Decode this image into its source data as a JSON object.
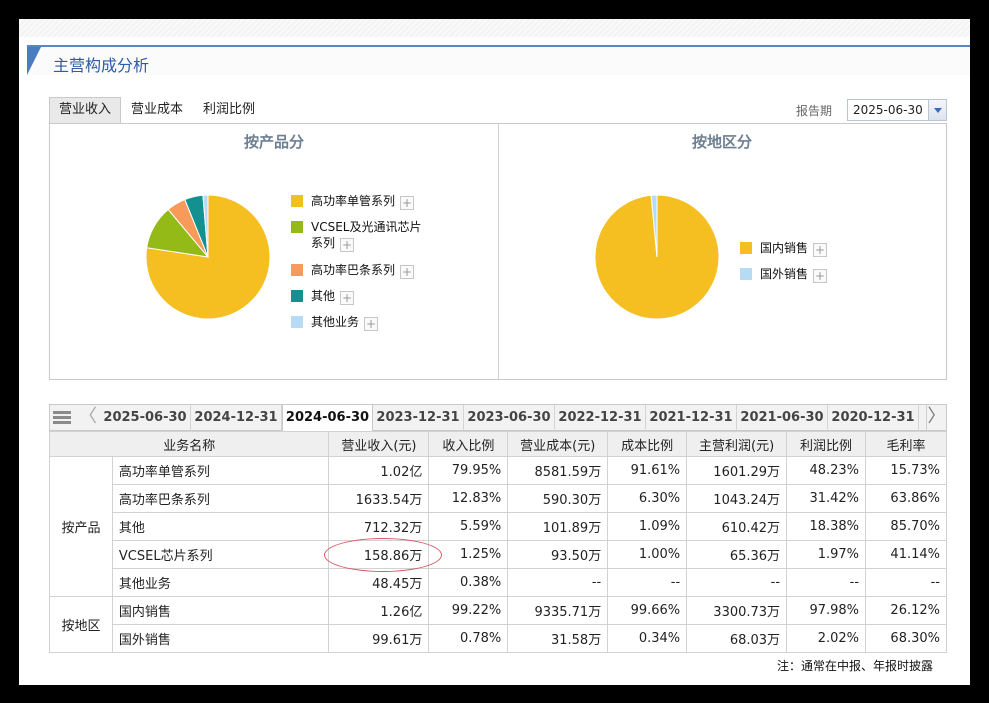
{
  "section_title": "主营构成分析",
  "top_tabs": [
    {
      "label": "营业收入",
      "active": true
    },
    {
      "label": "营业成本",
      "active": false
    },
    {
      "label": "利润比例",
      "active": false
    }
  ],
  "report_period": {
    "label": "报告期",
    "value": "2025-06-30"
  },
  "charts": {
    "product": {
      "title": "按产品分",
      "legend": [
        {
          "label": "高功率单管系列",
          "color": "#f5bf22"
        },
        {
          "label": "VCSEL及光通讯芯片系列",
          "color": "#93ba16"
        },
        {
          "label": "高功率巴条系列",
          "color": "#f89a5a"
        },
        {
          "label": "其他",
          "color": "#159091"
        },
        {
          "label": "其他业务",
          "color": "#b7dbf4"
        }
      ]
    },
    "region": {
      "title": "按地区分",
      "legend": [
        {
          "label": "国内销售",
          "color": "#f5bf22"
        },
        {
          "label": "国外销售",
          "color": "#b7dbf4"
        }
      ]
    },
    "plus_symbol": "+"
  },
  "chart_data": [
    {
      "type": "pie",
      "title": "按产品分",
      "categories": [
        "高功率单管系列",
        "VCSEL及光通讯芯片系列",
        "高功率巴条系列",
        "其他",
        "其他业务"
      ],
      "values": [
        77.4,
        11.5,
        5.0,
        4.8,
        1.3
      ],
      "colors": [
        "#f5bf22",
        "#93ba16",
        "#f89a5a",
        "#159091",
        "#b7dbf4"
      ]
    },
    {
      "type": "pie",
      "title": "按地区分",
      "categories": [
        "国内销售",
        "国外销售"
      ],
      "values": [
        98.5,
        1.5
      ],
      "colors": [
        "#f5bf22",
        "#b7dbf4"
      ]
    }
  ],
  "date_tabs": {
    "prev_symbol": "〈",
    "next_symbol": "〉",
    "items": [
      "2025-06-30",
      "2024-12-31",
      "2024-06-30",
      "2023-12-31",
      "2023-06-30",
      "2022-12-31",
      "2021-12-31",
      "2021-06-30",
      "2020-12-31"
    ],
    "active_index": 2
  },
  "table": {
    "headers": [
      "业务名称",
      "营业收入(元)",
      "收入比例",
      "营业成本(元)",
      "成本比例",
      "主营利润(元)",
      "利润比例",
      "毛利率"
    ],
    "groups": [
      {
        "label": "按产品",
        "rows": [
          [
            "高功率单管系列",
            "1.02亿",
            "79.95%",
            "8581.59万",
            "91.61%",
            "1601.29万",
            "48.23%",
            "15.73%"
          ],
          [
            "高功率巴条系列",
            "1633.54万",
            "12.83%",
            "590.30万",
            "6.30%",
            "1043.24万",
            "31.42%",
            "63.86%"
          ],
          [
            "其他",
            "712.32万",
            "5.59%",
            "101.89万",
            "1.09%",
            "610.42万",
            "18.38%",
            "85.70%"
          ],
          [
            "VCSEL芯片系列",
            "158.86万",
            "1.25%",
            "93.50万",
            "1.00%",
            "65.36万",
            "1.97%",
            "41.14%"
          ],
          [
            "其他业务",
            "48.45万",
            "0.38%",
            "--",
            "--",
            "--",
            "--",
            "--"
          ]
        ]
      },
      {
        "label": "按地区",
        "rows": [
          [
            "国内销售",
            "1.26亿",
            "99.22%",
            "9335.71万",
            "99.66%",
            "3300.73万",
            "97.98%",
            "26.12%"
          ],
          [
            "国外销售",
            "99.61万",
            "0.78%",
            "31.58万",
            "0.34%",
            "68.03万",
            "2.02%",
            "68.30%"
          ]
        ]
      }
    ]
  },
  "footnote": "注：通常在中报、年报时披露"
}
